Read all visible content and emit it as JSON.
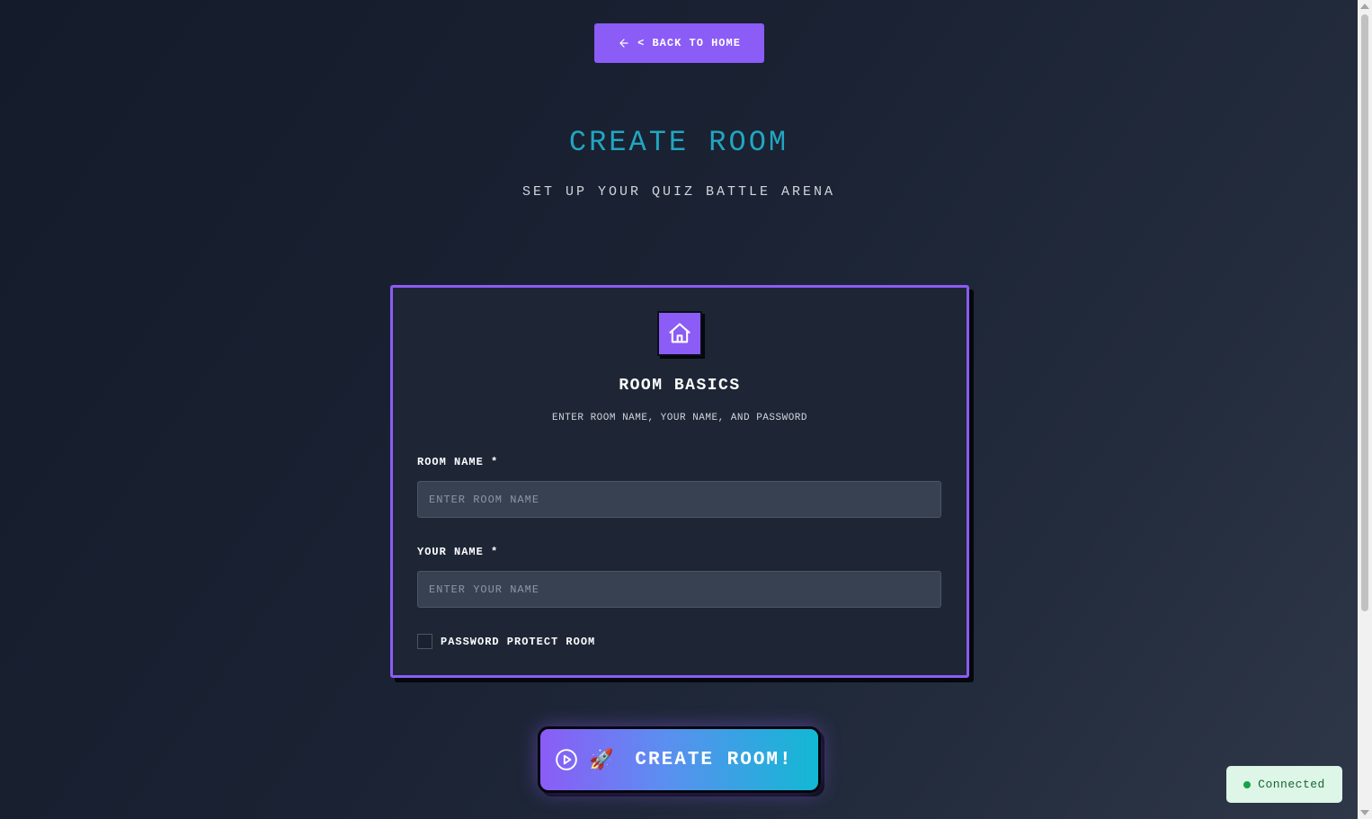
{
  "header": {
    "back_label": "< BACK TO HOME",
    "title": "CREATE ROOM",
    "subtitle": "SET UP YOUR QUIZ BATTLE ARENA"
  },
  "card": {
    "icon": "home-icon",
    "title": "ROOM BASICS",
    "description": "ENTER ROOM NAME, YOUR NAME, AND PASSWORD",
    "room_name_label": "ROOM NAME *",
    "room_name_placeholder": "ENTER ROOM NAME",
    "room_name_value": "",
    "your_name_label": "YOUR NAME *",
    "your_name_placeholder": "ENTER YOUR NAME",
    "your_name_value": "",
    "password_checkbox_label": "PASSWORD PROTECT ROOM",
    "password_checked": false
  },
  "create_button": {
    "label": "CREATE ROOM!",
    "icons": [
      "play-circle-icon",
      "rocket-icon"
    ]
  },
  "status": {
    "text": "Connected",
    "color": "#16a34a"
  },
  "colors": {
    "accent": "#8b5cf6",
    "title": "#22a6c0",
    "gradient_end": "#12b8d4"
  }
}
